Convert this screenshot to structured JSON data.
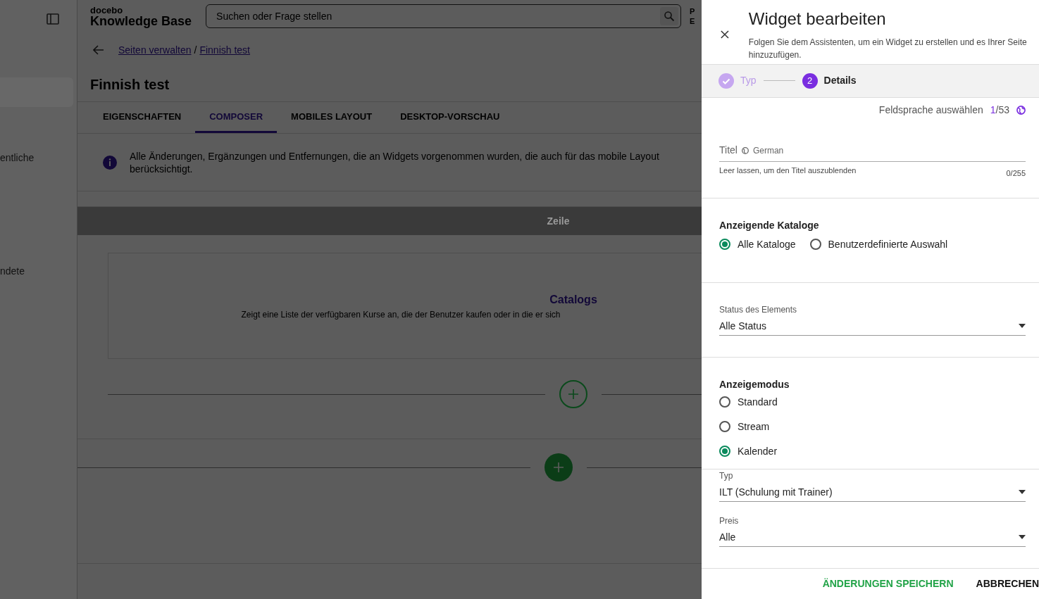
{
  "sidebar": {
    "items": [
      {
        "label": "entliche",
        "selected": false
      },
      {
        "label": "ndete",
        "selected": false
      }
    ]
  },
  "header": {
    "brand_small": "docebo",
    "brand_large": "Knowledge Base",
    "search": {
      "placeholder": "Suchen oder Frage stellen"
    },
    "user_lines": [
      "P",
      "E"
    ]
  },
  "breadcrumb": [
    {
      "label": "Seiten verwalten"
    },
    {
      "label": "Finnish test"
    }
  ],
  "breadcrumb_separator": "/",
  "page_title": "Finnish test",
  "tabs": [
    {
      "label": "EIGENSCHAFTEN",
      "selected": false
    },
    {
      "label": "COMPOSER",
      "selected": true
    },
    {
      "label": "MOBILES LAYOUT",
      "selected": false
    },
    {
      "label": "DESKTOP-VORSCHAU",
      "selected": false
    }
  ],
  "info_lines": [
    "Alle Änderungen, Ergänzungen und Entfernungen, die an Widgets vorgenommen wurden, die auch für das mobile Layout",
    "berücksichtigt."
  ],
  "row_bar": "Zeile",
  "widget_card": {
    "title": "Catalogs",
    "description": "Zeigt eine Liste der verfügbaren Kurse an, die der Benutzer kaufen oder in die er sich"
  },
  "drawer": {
    "title": "Widget bearbeiten",
    "subtitle": "Folgen Sie dem Assistenten, um ein Widget zu erstellen und es Ihrer Seite hinzuzufügen.",
    "steps": [
      {
        "label": "Typ",
        "selected": false,
        "done": true
      },
      {
        "label": "Details",
        "number": "2",
        "selected": true,
        "done": false
      }
    ],
    "language_label": "Feldsprache auswählen",
    "language_current": "1",
    "language_total": "/53",
    "title_field": {
      "label": "Titel",
      "language": "German",
      "helper": "Leer lassen, um den Titel auszublenden",
      "counter": "0/255"
    },
    "sections": [
      {
        "kind": "radios",
        "heading": "Anzeigende Kataloge",
        "inline": true,
        "options": [
          {
            "label": "Alle Kataloge",
            "selected": true
          },
          {
            "label": "Benutzerdefinierte Auswahl",
            "selected": false
          }
        ]
      },
      {
        "kind": "select",
        "label": "Status des Elements",
        "value": "Alle Status"
      },
      {
        "kind": "radios",
        "heading": "Anzeigemodus",
        "inline": false,
        "options": [
          {
            "label": "Standard",
            "selected": false
          },
          {
            "label": "Stream",
            "selected": false
          },
          {
            "label": "Kalender",
            "selected": true
          }
        ]
      },
      {
        "kind": "selects",
        "fields": [
          {
            "label": "Typ",
            "value": "ILT (Schulung mit Trainer)"
          },
          {
            "label": "Preis",
            "value": "Alle"
          }
        ]
      }
    ],
    "buttons": [
      {
        "label": "ÄNDERUNGEN SPEICHERN",
        "kind": "primary"
      },
      {
        "label": "ABBRECHEN",
        "kind": "secondary"
      }
    ]
  }
}
